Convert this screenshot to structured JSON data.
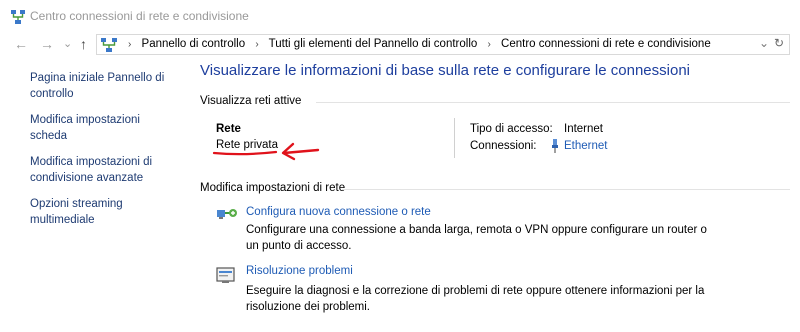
{
  "window": {
    "title": "Centro connessioni di rete e condivisione"
  },
  "nav": {
    "back_glyph": "←",
    "forward_glyph": "→",
    "history_glyph": "⌄",
    "up_glyph": "↑",
    "crumb_separator": "›",
    "breadcrumbs": [
      "Pannello di controllo",
      "Tutti gli elementi del Pannello di controllo",
      "Centro connessioni di rete e condivisione"
    ],
    "dropdown_glyph": "⌄",
    "refresh_glyph": "↻"
  },
  "sidebar": {
    "items": [
      "Pagina iniziale Pannello di controllo",
      "Modifica impostazioni scheda",
      "Modifica impostazioni di condivisione avanzate",
      "Opzioni streaming multimediale"
    ]
  },
  "main": {
    "heading": "Visualizzare le informazioni di base sulla rete e configurare le connessioni",
    "active_networks_title": "Visualizza reti attive",
    "network": {
      "name": "Rete",
      "category": "Rete privata",
      "access_type_label": "Tipo di accesso:",
      "access_type_value": "Internet",
      "connections_label": "Connessioni:",
      "connection_name": "Ethernet"
    },
    "settings_title": "Modifica impostazioni di rete",
    "tasks": [
      {
        "link": "Configura nuova connessione o rete",
        "desc": "Configurare una connessione a banda larga, remota o VPN oppure configurare un router o un punto di accesso.",
        "icon": "new-connection-icon"
      },
      {
        "link": "Risoluzione problemi",
        "desc": "Eseguire la diagnosi e la correzione di problemi di rete oppure ottenere informazioni per la risoluzione dei problemi.",
        "icon": "troubleshoot-icon"
      }
    ]
  },
  "colors": {
    "heading": "#1e3f9e",
    "link": "#1e5bb5",
    "annotation": "#e0121b"
  }
}
